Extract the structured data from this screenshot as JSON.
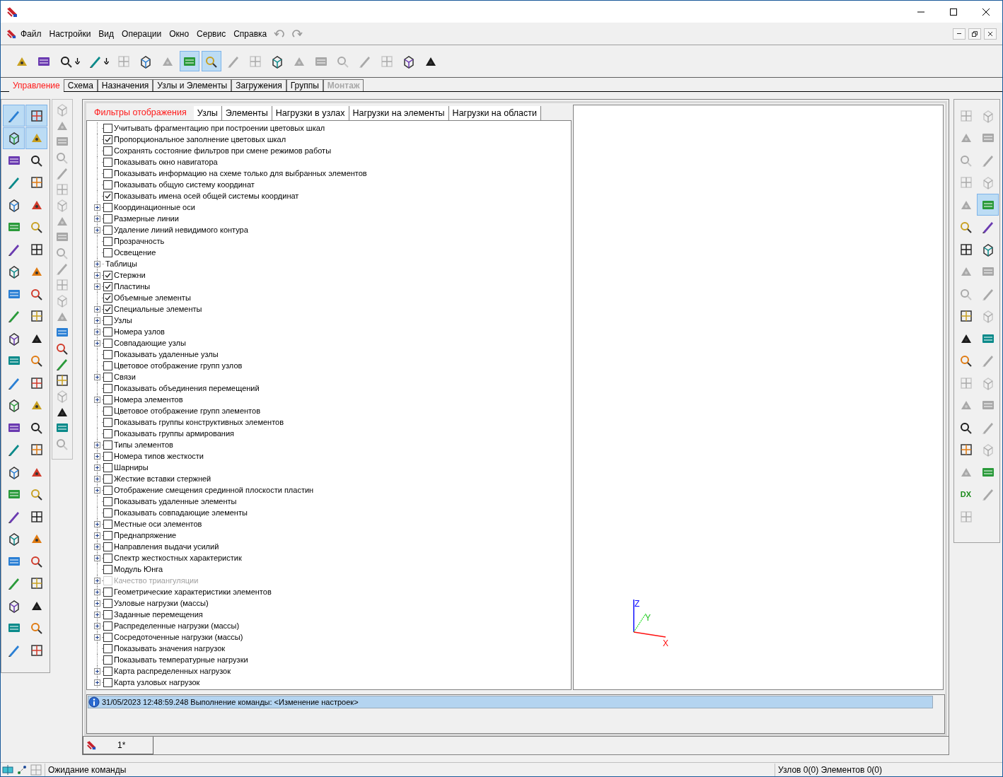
{
  "menu": [
    "Файл",
    "Настройки",
    "Вид",
    "Операции",
    "Окно",
    "Сервис",
    "Справка"
  ],
  "main_toolbar": [
    {
      "selected": false,
      "disabled": false,
      "dropdown": false
    },
    {
      "selected": false,
      "disabled": false,
      "dropdown": false
    },
    {
      "selected": false,
      "disabled": false,
      "dropdown": true
    },
    {
      "selected": false,
      "disabled": false,
      "dropdown": true
    },
    {
      "selected": false,
      "disabled": true,
      "dropdown": false
    },
    {
      "selected": false,
      "disabled": false,
      "dropdown": false
    },
    {
      "selected": false,
      "disabled": true,
      "dropdown": false
    },
    {
      "selected": true,
      "disabled": false,
      "dropdown": false
    },
    {
      "selected": true,
      "disabled": false,
      "dropdown": false
    },
    {
      "selected": false,
      "disabled": true,
      "dropdown": false
    },
    {
      "selected": false,
      "disabled": true,
      "dropdown": false
    },
    {
      "selected": false,
      "disabled": false,
      "dropdown": false
    },
    {
      "selected": false,
      "disabled": true,
      "dropdown": false
    },
    {
      "selected": false,
      "disabled": true,
      "dropdown": false
    },
    {
      "selected": false,
      "disabled": true,
      "dropdown": false
    },
    {
      "selected": false,
      "disabled": true,
      "dropdown": false
    },
    {
      "selected": false,
      "disabled": true,
      "dropdown": false
    },
    {
      "selected": false,
      "disabled": false,
      "dropdown": false
    },
    {
      "selected": false,
      "disabled": false,
      "dropdown": false
    }
  ],
  "ribbon_tabs": [
    {
      "label": "Управление",
      "selected": true,
      "disabled": false
    },
    {
      "label": "Схема",
      "selected": false,
      "disabled": false
    },
    {
      "label": "Назначения",
      "selected": false,
      "disabled": false
    },
    {
      "label": "Узлы и Элементы",
      "selected": false,
      "disabled": false
    },
    {
      "label": "Загружения",
      "selected": false,
      "disabled": false
    },
    {
      "label": "Группы",
      "selected": false,
      "disabled": false
    },
    {
      "label": "Монтаж",
      "selected": false,
      "disabled": true
    }
  ],
  "left_toolbar": [
    {
      "selected": true
    },
    {
      "selected": true
    },
    {
      "selected": true
    },
    {
      "selected": true
    },
    {
      "selected": false
    },
    {
      "selected": false
    },
    {
      "selected": false
    },
    {
      "selected": false
    },
    {
      "selected": false
    },
    {
      "selected": false
    },
    {
      "selected": false
    },
    {
      "selected": false
    },
    {
      "selected": false
    },
    {
      "selected": false
    },
    {
      "selected": false
    },
    {
      "selected": false
    },
    {
      "selected": false
    },
    {
      "selected": false
    },
    {
      "selected": false
    },
    {
      "selected": false
    },
    {
      "selected": false
    },
    {
      "selected": false
    },
    {
      "selected": false
    },
    {
      "selected": false
    },
    {
      "selected": false
    },
    {
      "selected": false
    },
    {
      "selected": false
    },
    {
      "selected": false
    },
    {
      "selected": false
    },
    {
      "selected": false
    },
    {
      "selected": false
    },
    {
      "selected": false
    },
    {
      "selected": false
    },
    {
      "selected": false
    },
    {
      "selected": false
    },
    {
      "selected": false
    },
    {
      "selected": false
    },
    {
      "selected": false
    },
    {
      "selected": false
    },
    {
      "selected": false
    },
    {
      "selected": false
    },
    {
      "selected": false
    },
    {
      "selected": false
    },
    {
      "selected": false
    },
    {
      "selected": false
    },
    {
      "selected": false
    },
    {
      "selected": false
    },
    {
      "selected": false
    },
    {
      "selected": false
    },
    {
      "selected": false
    }
  ],
  "second_toolbar": [
    {
      "disabled": true
    },
    {
      "disabled": true
    },
    {
      "disabled": true
    },
    {
      "disabled": true
    },
    {
      "disabled": true
    },
    {
      "disabled": true
    },
    {
      "disabled": true
    },
    {
      "disabled": true
    },
    {
      "disabled": true
    },
    {
      "disabled": true
    },
    {
      "disabled": true
    },
    {
      "disabled": true
    },
    {
      "disabled": true
    },
    {
      "disabled": true
    },
    {
      "disabled": false
    },
    {
      "disabled": false
    },
    {
      "disabled": false
    },
    {
      "disabled": false
    },
    {
      "disabled": true
    },
    {
      "disabled": false
    },
    {
      "disabled": false
    },
    {
      "disabled": true
    }
  ],
  "panel_tabs": [
    {
      "label": "Фильтры отображения",
      "selected": true
    },
    {
      "label": "Узлы",
      "selected": false
    },
    {
      "label": "Элементы",
      "selected": false
    },
    {
      "label": "Нагрузки в узлах",
      "selected": false
    },
    {
      "label": "Нагрузки на элементы",
      "selected": false
    },
    {
      "label": "Нагрузки на области",
      "selected": false
    }
  ],
  "filters": [
    {
      "kind": "checkbox",
      "label": "Учитывать фрагментацию при построении цветовых шкал",
      "checked": false,
      "expandable": false,
      "disabled": false
    },
    {
      "kind": "checkbox",
      "label": "Пропорциональное заполнение цветовых шкал",
      "checked": true,
      "expandable": false,
      "disabled": false
    },
    {
      "kind": "checkbox",
      "label": "Сохранять состояние фильтров при смене режимов работы",
      "checked": false,
      "expandable": false,
      "disabled": false
    },
    {
      "kind": "checkbox",
      "label": "Показывать окно навигатора",
      "checked": false,
      "expandable": false,
      "disabled": false
    },
    {
      "kind": "checkbox",
      "label": "Показывать информацию на схеме только для выбранных элементов",
      "checked": false,
      "expandable": false,
      "disabled": false
    },
    {
      "kind": "checkbox",
      "label": "Показывать общую систему координат",
      "checked": false,
      "expandable": false,
      "disabled": false
    },
    {
      "kind": "checkbox",
      "label": "Показывать имена осей общей системы координат",
      "checked": true,
      "expandable": false,
      "disabled": false
    },
    {
      "kind": "checkbox",
      "label": "Координационные оси",
      "checked": false,
      "expandable": true,
      "disabled": false
    },
    {
      "kind": "checkbox",
      "label": "Размерные линии",
      "checked": false,
      "expandable": true,
      "disabled": false
    },
    {
      "kind": "checkbox",
      "label": "Удаление линий невидимого контура",
      "checked": false,
      "expandable": true,
      "disabled": false
    },
    {
      "kind": "checkbox",
      "label": "Прозрачность",
      "checked": false,
      "expandable": false,
      "disabled": false
    },
    {
      "kind": "checkbox",
      "label": "Освещение",
      "checked": false,
      "expandable": false,
      "disabled": false
    },
    {
      "kind": "group",
      "label": "Таблицы",
      "expandable": true
    },
    {
      "kind": "checkbox",
      "label": "Стержни",
      "checked": true,
      "expandable": true,
      "disabled": false
    },
    {
      "kind": "checkbox",
      "label": "Пластины",
      "checked": true,
      "expandable": true,
      "disabled": false
    },
    {
      "kind": "checkbox",
      "label": "Объемные элементы",
      "checked": true,
      "expandable": false,
      "disabled": false
    },
    {
      "kind": "checkbox",
      "label": "Специальные элементы",
      "checked": true,
      "expandable": true,
      "disabled": false
    },
    {
      "kind": "checkbox",
      "label": "Узлы",
      "checked": false,
      "expandable": true,
      "disabled": false
    },
    {
      "kind": "checkbox",
      "label": "Номера узлов",
      "checked": false,
      "expandable": true,
      "disabled": false
    },
    {
      "kind": "checkbox",
      "label": "Совпадающие узлы",
      "checked": false,
      "expandable": true,
      "disabled": false
    },
    {
      "kind": "checkbox",
      "label": "Показывать удаленные узлы",
      "checked": false,
      "expandable": false,
      "disabled": false
    },
    {
      "kind": "checkbox",
      "label": "Цветовое отображение групп узлов",
      "checked": false,
      "expandable": false,
      "disabled": false
    },
    {
      "kind": "checkbox",
      "label": "Связи",
      "checked": false,
      "expandable": true,
      "disabled": false
    },
    {
      "kind": "checkbox",
      "label": "Показывать объединения перемещений",
      "checked": false,
      "expandable": false,
      "disabled": false
    },
    {
      "kind": "checkbox",
      "label": "Номера элементов",
      "checked": false,
      "expandable": true,
      "disabled": false
    },
    {
      "kind": "checkbox",
      "label": "Цветовое отображение групп элементов",
      "checked": false,
      "expandable": false,
      "disabled": false
    },
    {
      "kind": "checkbox",
      "label": "Показывать группы конструктивных элементов",
      "checked": false,
      "expandable": false,
      "disabled": false
    },
    {
      "kind": "checkbox",
      "label": "Показывать группы армирования",
      "checked": false,
      "expandable": false,
      "disabled": false
    },
    {
      "kind": "checkbox",
      "label": "Типы элементов",
      "checked": false,
      "expandable": true,
      "disabled": false
    },
    {
      "kind": "checkbox",
      "label": "Номера типов жесткости",
      "checked": false,
      "expandable": true,
      "disabled": false
    },
    {
      "kind": "checkbox",
      "label": "Шарниры",
      "checked": false,
      "expandable": true,
      "disabled": false
    },
    {
      "kind": "checkbox",
      "label": "Жесткие вставки стержней",
      "checked": false,
      "expandable": true,
      "disabled": false
    },
    {
      "kind": "checkbox",
      "label": "Отображение смещения срединной плоскости пластин",
      "checked": false,
      "expandable": true,
      "disabled": false
    },
    {
      "kind": "checkbox",
      "label": "Показывать удаленные элементы",
      "checked": false,
      "expandable": false,
      "disabled": false
    },
    {
      "kind": "checkbox",
      "label": "Показывать совпадающие элементы",
      "checked": false,
      "expandable": false,
      "disabled": false
    },
    {
      "kind": "checkbox",
      "label": "Местные оси элементов",
      "checked": false,
      "expandable": true,
      "disabled": false
    },
    {
      "kind": "checkbox",
      "label": "Преднапряжение",
      "checked": false,
      "expandable": true,
      "disabled": false
    },
    {
      "kind": "checkbox",
      "label": "Направления выдачи усилий",
      "checked": false,
      "expandable": true,
      "disabled": false
    },
    {
      "kind": "checkbox",
      "label": "Спектр жесткостных характеристик",
      "checked": false,
      "expandable": true,
      "disabled": false
    },
    {
      "kind": "checkbox",
      "label": "Модуль Юнга",
      "checked": false,
      "expandable": false,
      "disabled": false
    },
    {
      "kind": "checkbox",
      "label": "Качество триангуляции",
      "checked": false,
      "expandable": true,
      "disabled": true
    },
    {
      "kind": "checkbox",
      "label": "Геометрические характеристики элементов",
      "checked": false,
      "expandable": true,
      "disabled": false
    },
    {
      "kind": "checkbox",
      "label": "Узловые нагрузки (массы)",
      "checked": false,
      "expandable": true,
      "disabled": false
    },
    {
      "kind": "checkbox",
      "label": "Заданные перемещения",
      "checked": false,
      "expandable": true,
      "disabled": false
    },
    {
      "kind": "checkbox",
      "label": "Распределенные нагрузки (массы)",
      "checked": false,
      "expandable": true,
      "disabled": false
    },
    {
      "kind": "checkbox",
      "label": "Сосредоточенные нагрузки (массы)",
      "checked": false,
      "expandable": true,
      "disabled": false
    },
    {
      "kind": "checkbox",
      "label": "Показывать значения нагрузок",
      "checked": false,
      "expandable": false,
      "disabled": false
    },
    {
      "kind": "checkbox",
      "label": "Показывать температурные нагрузки",
      "checked": false,
      "expandable": false,
      "disabled": false
    },
    {
      "kind": "checkbox",
      "label": "Карта распределенных нагрузок",
      "checked": false,
      "expandable": true,
      "disabled": false
    },
    {
      "kind": "checkbox",
      "label": "Карта узловых нагрузок",
      "checked": false,
      "expandable": true,
      "disabled": false
    }
  ],
  "axes": {
    "z": "Z",
    "y": "Y",
    "x": "X"
  },
  "right_toolbar": [
    {
      "selected": false,
      "disabled": true
    },
    {
      "selected": false,
      "disabled": true
    },
    {
      "selected": false,
      "disabled": true
    },
    {
      "selected": false,
      "disabled": true
    },
    {
      "selected": false,
      "disabled": true
    },
    {
      "selected": false,
      "disabled": true
    },
    {
      "selected": false,
      "disabled": true
    },
    {
      "selected": false,
      "disabled": true
    },
    {
      "selected": false,
      "disabled": true
    },
    {
      "selected": true,
      "disabled": false
    },
    {
      "selected": false,
      "disabled": false
    },
    {
      "selected": false,
      "disabled": false
    },
    {
      "selected": false,
      "disabled": false
    },
    {
      "selected": false,
      "disabled": false
    },
    {
      "selected": false,
      "disabled": true
    },
    {
      "selected": false,
      "disabled": true
    },
    {
      "selected": false,
      "disabled": true
    },
    {
      "selected": false,
      "disabled": true
    },
    {
      "selected": false,
      "disabled": false
    },
    {
      "selected": false,
      "disabled": true
    },
    {
      "selected": false,
      "disabled": false
    },
    {
      "selected": false,
      "disabled": false
    },
    {
      "selected": false,
      "disabled": false
    },
    {
      "selected": false,
      "disabled": true
    },
    {
      "selected": false,
      "disabled": true
    },
    {
      "selected": false,
      "disabled": true
    },
    {
      "selected": false,
      "disabled": true
    },
    {
      "selected": false,
      "disabled": true
    },
    {
      "selected": false,
      "disabled": false
    },
    {
      "selected": false,
      "disabled": true
    },
    {
      "selected": false,
      "disabled": false
    },
    {
      "selected": false,
      "disabled": true
    },
    {
      "selected": false,
      "disabled": true
    },
    {
      "selected": false,
      "disabled": false
    },
    {
      "selected": false,
      "disabled": false,
      "label": "DX"
    },
    {
      "selected": false,
      "disabled": true
    },
    {
      "selected": false,
      "disabled": true
    }
  ],
  "log": {
    "date": "31/05/2023",
    "time": "12:48:59.248",
    "message": "Выполнение команды: <Изменение настроек>"
  },
  "document_tab": {
    "label": "1*"
  },
  "status_bar": {
    "message": "Ожидание команды",
    "counts": "Узлов 0(0) Элементов 0(0)"
  }
}
